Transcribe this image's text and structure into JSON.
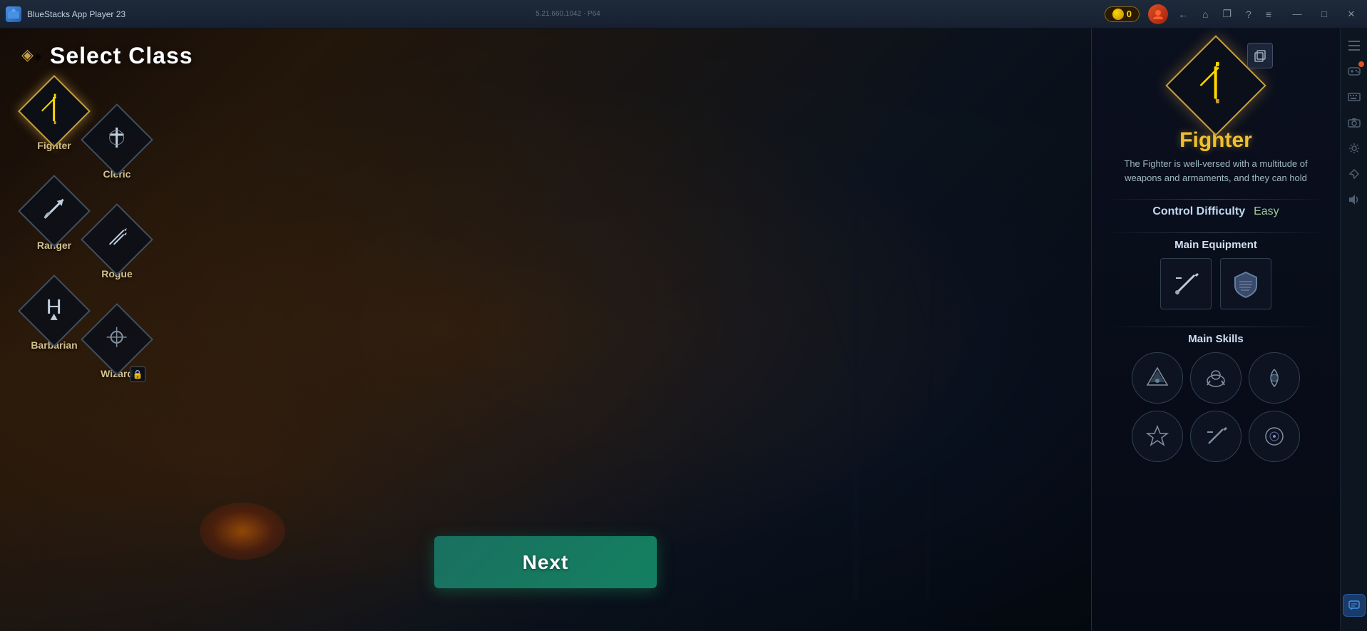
{
  "titlebar": {
    "app_icon": "BS",
    "app_name": "BlueStacks App Player 23",
    "app_version": "5.21.660.1042 · P64",
    "coins": "0",
    "nav_back": "←",
    "nav_home": "⌂",
    "nav_tab": "❐",
    "help_icon": "?",
    "menu_icon": "≡",
    "minimize": "—",
    "maximize": "□",
    "close": "✕"
  },
  "game": {
    "title": "Select Class",
    "next_button": "Next",
    "classes": [
      {
        "id": "fighter",
        "name": "Fighter",
        "icon": "⚔",
        "locked": false,
        "active": true
      },
      {
        "id": "cleric",
        "name": "Cleric",
        "icon": "✝",
        "locked": false,
        "active": false
      },
      {
        "id": "ranger",
        "name": "Ranger",
        "icon": "🏹",
        "locked": false,
        "active": false
      },
      {
        "id": "rogue",
        "name": "Rogue",
        "icon": "🗡",
        "locked": false,
        "active": false
      },
      {
        "id": "barbarian",
        "name": "Barbarian",
        "icon": "⚒",
        "locked": false,
        "active": false
      },
      {
        "id": "wizard",
        "name": "Wizard",
        "icon": "🔮",
        "locked": true,
        "active": false
      }
    ]
  },
  "right_panel": {
    "class_name": "Fighter",
    "class_icon": "⚔",
    "description": "The Fighter is well-versed with a multitude of weapons and armaments, and they can hold",
    "control_difficulty_label": "Control Difficulty",
    "control_difficulty_value": "Easy",
    "main_equipment_label": "Main Equipment",
    "equipment": [
      {
        "id": "sword",
        "icon": "🗡"
      },
      {
        "id": "shield",
        "icon": "🛡"
      }
    ],
    "main_skills_label": "Main Skills",
    "skills": [
      {
        "id": "skill1",
        "icon": "🛡"
      },
      {
        "id": "skill2",
        "icon": "🐎"
      },
      {
        "id": "skill3",
        "icon": "🌀"
      },
      {
        "id": "skill4",
        "icon": "⚡"
      },
      {
        "id": "skill5",
        "icon": "⚔"
      },
      {
        "id": "skill6",
        "icon": "🧿"
      }
    ],
    "copy_button": "⧉"
  },
  "side_icons": [
    {
      "id": "icon1",
      "icon": "☰",
      "has_notification": false
    },
    {
      "id": "icon2",
      "icon": "🎮",
      "has_notification": true
    },
    {
      "id": "icon3",
      "icon": "⌨",
      "has_notification": false
    },
    {
      "id": "icon4",
      "icon": "📷",
      "has_notification": false
    },
    {
      "id": "icon5",
      "icon": "⚙",
      "has_notification": false
    },
    {
      "id": "icon6",
      "icon": "✈",
      "has_notification": false
    },
    {
      "id": "icon7",
      "icon": "🔊",
      "has_notification": false
    },
    {
      "id": "chat",
      "icon": "💬",
      "has_notification": false
    }
  ],
  "colors": {
    "accent_gold": "#c8a040",
    "fighter_name": "#f0c030",
    "easy_color": "#80c880",
    "button_green": "#148060",
    "bg_dark": "#0d1520"
  }
}
